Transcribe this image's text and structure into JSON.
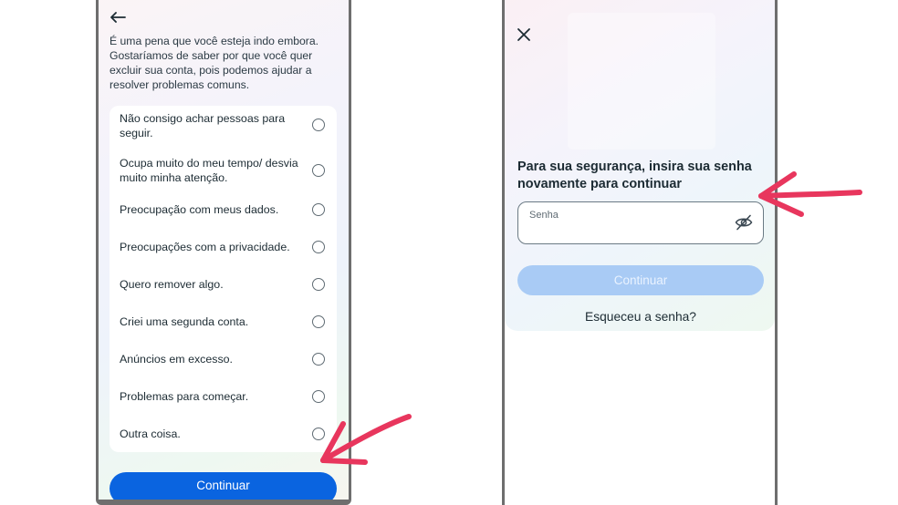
{
  "left_screen": {
    "intro": "É uma pena que você esteja indo embora. Gostaríamos de saber por que você quer excluir sua conta, pois podemos ajudar a resolver problemas comuns.",
    "reasons": [
      {
        "label": "Não consigo achar pessoas para seguir."
      },
      {
        "label": "Ocupa muito do meu tempo/ desvia muito minha atenção."
      },
      {
        "label": "Preocupação com meus dados."
      },
      {
        "label": "Preocupações com a privacidade."
      },
      {
        "label": "Quero remover algo."
      },
      {
        "label": "Criei uma segunda conta."
      },
      {
        "label": "Anúncios em excesso."
      },
      {
        "label": "Problemas para começar."
      },
      {
        "label": "Outra coisa."
      }
    ],
    "continue_label": "Continuar"
  },
  "right_screen": {
    "title": "Para sua segurança, insira sua senha novamente para continuar",
    "password_label": "Senha",
    "continue_label": "Continuar",
    "forgot_label": "Esqueceu a senha?"
  },
  "colors": {
    "primary_button": "#0a64e0",
    "disabled_button": "#a9cbf5",
    "annotation_arrow": "#e8365d"
  }
}
